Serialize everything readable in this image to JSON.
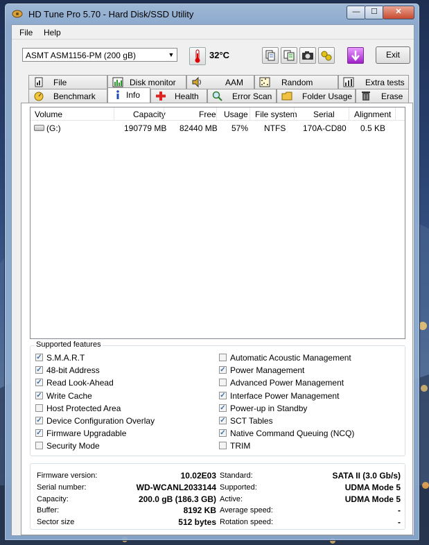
{
  "window": {
    "title": "HD Tune Pro 5.70 - Hard Disk/SSD Utility"
  },
  "titlebar_buttons": {
    "minimize": "—",
    "maximize": "☐",
    "close": "✕"
  },
  "menu": {
    "file": "File",
    "help": "Help"
  },
  "toolbar": {
    "drive": "ASMT    ASM1156-PM (200 gB)",
    "temperature": "32°C",
    "exit_label": "Exit"
  },
  "tabs_top": [
    "File Benchmark",
    "Disk monitor",
    "AAM",
    "Random Access",
    "Extra tests"
  ],
  "tabs_bottom": [
    "Benchmark",
    "Info",
    "Health",
    "Error Scan",
    "Folder Usage",
    "Erase"
  ],
  "active_tab": "Info",
  "volumes": {
    "columns": [
      "Volume",
      "Capacity",
      "Free",
      "Usage",
      "File system",
      "Serial",
      "Alignment"
    ],
    "rows": [
      {
        "volume": "(G:)",
        "capacity": "190779 MB",
        "free": "82440 MB",
        "usage": "57%",
        "fs": "NTFS",
        "serial": "170A-CD80",
        "alignment": "0.5 KB"
      }
    ]
  },
  "features": {
    "title": "Supported features",
    "left": [
      {
        "label": "S.M.A.R.T",
        "checked": true
      },
      {
        "label": "48-bit Address",
        "checked": true
      },
      {
        "label": "Read Look-Ahead",
        "checked": true
      },
      {
        "label": "Write Cache",
        "checked": true
      },
      {
        "label": "Host Protected Area",
        "checked": false
      },
      {
        "label": "Device Configuration Overlay",
        "checked": true
      },
      {
        "label": "Firmware Upgradable",
        "checked": true
      },
      {
        "label": "Security Mode",
        "checked": false
      }
    ],
    "right": [
      {
        "label": "Automatic Acoustic Management",
        "checked": false
      },
      {
        "label": "Power Management",
        "checked": true
      },
      {
        "label": "Advanced Power Management",
        "checked": false
      },
      {
        "label": "Interface Power Management",
        "checked": true
      },
      {
        "label": "Power-up in Standby",
        "checked": true
      },
      {
        "label": "SCT Tables",
        "checked": true
      },
      {
        "label": "Native Command Queuing (NCQ)",
        "checked": true
      },
      {
        "label": "TRIM",
        "checked": false
      }
    ]
  },
  "details": {
    "left": [
      {
        "label": "Firmware version:",
        "value": "10.02E03"
      },
      {
        "label": "Serial number:",
        "value": "WD-WCANL2033144"
      },
      {
        "label": "Capacity:",
        "value": "200.0 gB (186.3 GB)"
      },
      {
        "label": "Buffer:",
        "value": "8192 KB"
      },
      {
        "label": "Sector size",
        "value": "512 bytes"
      }
    ],
    "right": [
      {
        "label": "Standard:",
        "value": "SATA II (3.0 Gb/s)"
      },
      {
        "label": "Supported:",
        "value": "UDMA Mode 5"
      },
      {
        "label": "Active:",
        "value": "UDMA Mode 5"
      },
      {
        "label": "Average speed:",
        "value": "-"
      },
      {
        "label": "Rotation speed:",
        "value": "-"
      }
    ]
  },
  "icons": {
    "toolbar": [
      "copy-icon",
      "copy-all-icon",
      "camera-icon",
      "options-icon",
      "download-icon"
    ],
    "tabs_top": [
      "file-benchmark-icon",
      "disk-monitor-icon",
      "speaker-icon",
      "random-access-icon",
      "extra-tests-icon"
    ],
    "tabs_bottom": [
      "benchmark-icon",
      "info-icon",
      "health-icon",
      "error-scan-icon",
      "folder-icon",
      "erase-icon"
    ]
  }
}
